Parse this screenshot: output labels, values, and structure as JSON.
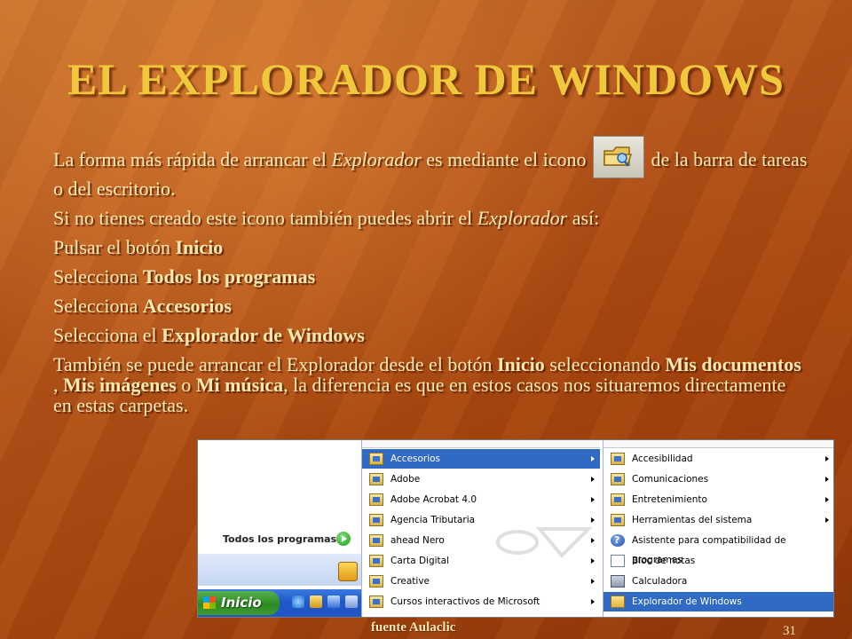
{
  "slide": {
    "title": "EL EXPLORADOR DE WINDOWS",
    "p1_a": "La forma más rápida de arrancar el ",
    "p1_em": "Explorador",
    "p1_b": " es mediante el icono",
    "p1_c": " de la barra de tareas o del escritorio.",
    "p2_a": "Si no tienes creado este icono también puedes abrir el ",
    "p2_em": "Explorador",
    "p2_b": " así:",
    "p3_a": "Pulsar el botón ",
    "p3_b": "Inicio",
    "p4_a": "Selecciona ",
    "p4_b": "Todos los programas",
    "p5_a": "Selecciona ",
    "p5_b": "Accesorios",
    "p6_a": "Selecciona el ",
    "p6_b": "Explorador de Windows",
    "p7_a": "También se puede arrancar el Explorador desde el botón ",
    "p7_b": "Inicio",
    "p7_c": " seleccionando ",
    "p7_d": "Mis documentos",
    "p7_e": " , ",
    "p7_f": "Mis imágenes",
    "p7_g": " o ",
    "p7_h": "Mi música",
    "p7_i": ", la diferencia es que en estos casos nos situaremos directamente en estas carpetas.",
    "footer_source": "fuente Aulaclic",
    "page_number": "31"
  },
  "screenshot": {
    "todos_label": "Todos los programas",
    "start_label": "Inicio",
    "programs_menu": [
      {
        "label": "Accesorios",
        "selected": true
      },
      {
        "label": "Adobe",
        "selected": false
      },
      {
        "label": "Adobe Acrobat 4.0",
        "selected": false
      },
      {
        "label": "Agencia Tributaria",
        "selected": false
      },
      {
        "label": "ahead Nero",
        "selected": false
      },
      {
        "label": "Carta Digital",
        "selected": false
      },
      {
        "label": "Creative",
        "selected": false
      },
      {
        "label": "Cursos interactivos de Microsoft",
        "selected": false
      }
    ],
    "accessories_menu": [
      {
        "label": "Accesibilidad",
        "submenu": true,
        "icon": "program-group-icon"
      },
      {
        "label": "Comunicaciones",
        "submenu": true,
        "icon": "program-group-icon"
      },
      {
        "label": "Entretenimiento",
        "submenu": true,
        "icon": "program-group-icon"
      },
      {
        "label": "Herramientas del sistema",
        "submenu": true,
        "icon": "program-group-icon"
      },
      {
        "label": "Asistente para compatibilidad de programas",
        "submenu": false,
        "icon": "help-icon"
      },
      {
        "label": "Bloc de notas",
        "submenu": false,
        "icon": "notepad-icon"
      },
      {
        "label": "Calculadora",
        "submenu": false,
        "icon": "calculator-icon"
      },
      {
        "label": "Explorador de Windows",
        "submenu": false,
        "icon": "explorer-folder-icon",
        "selected": true
      }
    ],
    "colors": {
      "menu_highlight": "#316ac5",
      "start_green": "#3b9a30",
      "taskbar_blue": "#2456c8"
    }
  }
}
